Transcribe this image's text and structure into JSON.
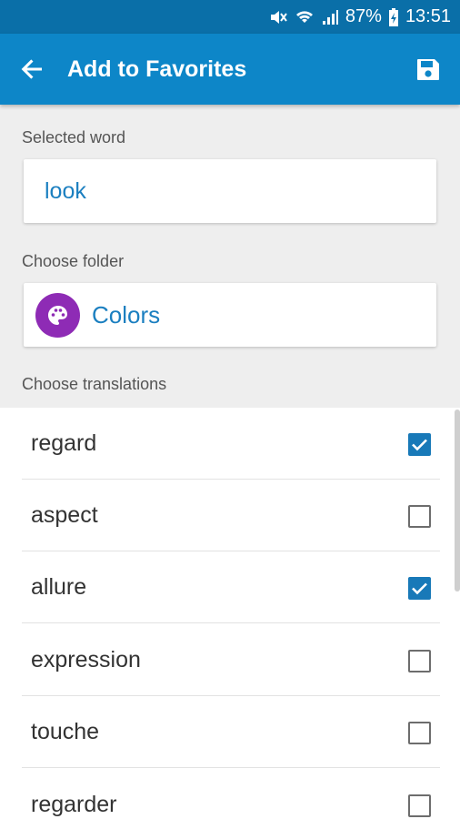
{
  "status_bar": {
    "battery": "87%",
    "time": "13:51"
  },
  "app_bar": {
    "title": "Add to Favorites",
    "back_icon": "arrow-back-icon",
    "save_icon": "save-icon"
  },
  "selected_word": {
    "label": "Selected word",
    "value": "look"
  },
  "folder": {
    "label": "Choose folder",
    "name": "Colors",
    "icon": "palette-icon",
    "icon_color": "#8e2bb5"
  },
  "translations": {
    "label": "Choose translations",
    "items": [
      {
        "text": "regard",
        "checked": true
      },
      {
        "text": "aspect",
        "checked": false
      },
      {
        "text": "allure",
        "checked": true
      },
      {
        "text": "expression",
        "checked": false
      },
      {
        "text": "touche",
        "checked": false
      },
      {
        "text": "regarder",
        "checked": false
      }
    ]
  },
  "colors": {
    "status_bar": "#0a6fa8",
    "app_bar": "#0d86c8",
    "accent_text": "#1b7fc0",
    "checkbox_checked": "#1879b8"
  }
}
